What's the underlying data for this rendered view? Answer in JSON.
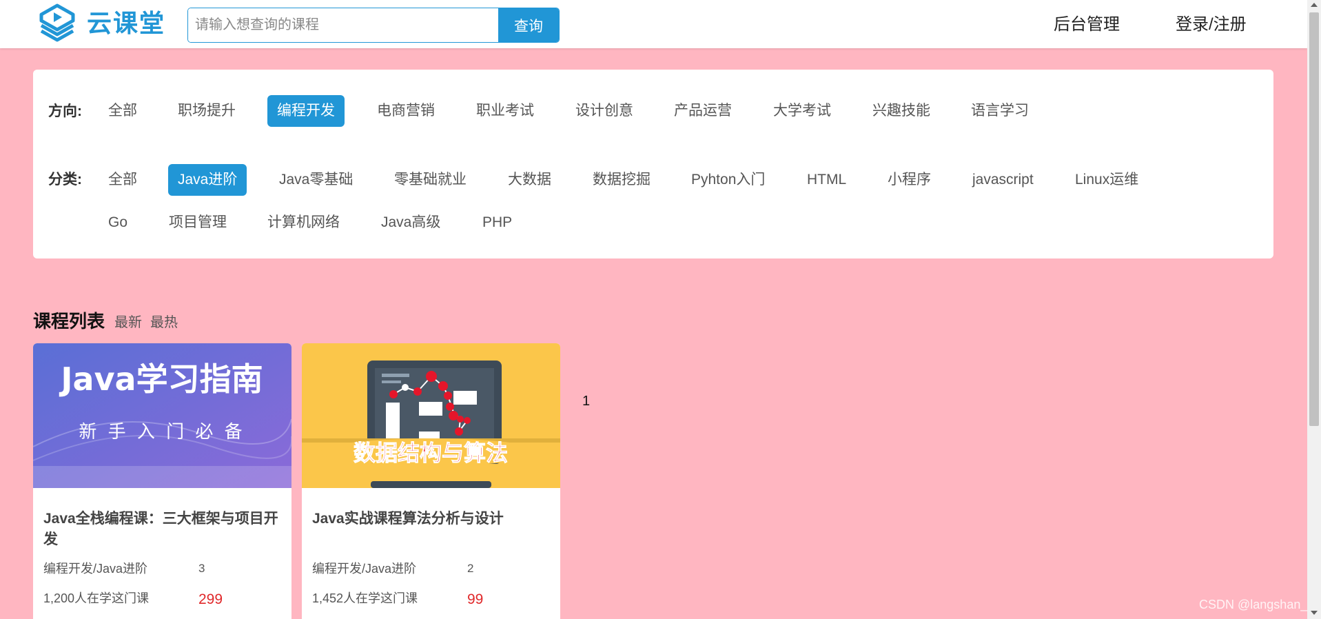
{
  "header": {
    "brand": "云课堂",
    "search_placeholder": "请输入想查询的课程",
    "search_button": "查询",
    "nav": [
      "后台管理",
      "登录/注册"
    ]
  },
  "filters": {
    "direction_label": "方向:",
    "directions": [
      "全部",
      "职场提升",
      "编程开发",
      "电商营销",
      "职业考试",
      "设计创意",
      "产品运营",
      "大学考试",
      "兴趣技能",
      "语言学习"
    ],
    "direction_active": "编程开发",
    "category_label": "分类:",
    "categories": [
      "全部",
      "Java进阶",
      "Java零基础",
      "零基础就业",
      "大数据",
      "数据挖掘",
      "Pyhton入门",
      "HTML",
      "小程序",
      "javascript",
      "Linux运维",
      "Go",
      "项目管理",
      "计算机网络",
      "Java高级",
      "PHP"
    ],
    "category_active": "Java进阶"
  },
  "course_list": {
    "title": "课程列表",
    "sort_options": [
      "最新",
      "最热"
    ],
    "courses": [
      {
        "cover_line1": "Java学习指南",
        "cover_line2": "新 手 入 门 必 备",
        "title": "Java全栈编程课：三大框架与项目开发",
        "category": "编程开发/Java进阶",
        "lessons": "3",
        "learners": "1,200人在学这门课",
        "price": "299"
      },
      {
        "cover_line1": "数据结构与算法",
        "title": "Java实战课程算法分析与设计",
        "category": "编程开发/Java进阶",
        "lessons": "2",
        "learners": "1,452人在学这门课",
        "price": "99"
      }
    ],
    "pagination": "1"
  },
  "watermark": "CSDN @langshan_",
  "colors": {
    "primary": "#2196d6",
    "page_bg": "#ffb6c1",
    "price": "#e0282a"
  }
}
